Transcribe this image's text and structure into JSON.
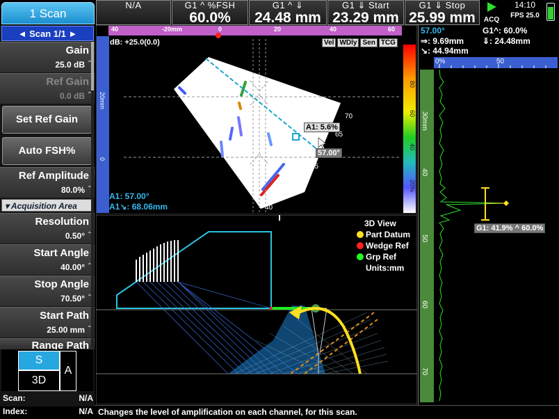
{
  "header": {
    "tab_label": "1 Scan",
    "readings": [
      {
        "label": "N/A",
        "value": ""
      },
      {
        "label": "G1 ^ %FSH",
        "value": "60.0%"
      },
      {
        "label": "G1 ^ ⇓",
        "value": "24.48 mm"
      },
      {
        "label": "G1 ⇓ Start",
        "value": "23.29 mm"
      },
      {
        "label": "G1 ⇓ Stop",
        "value": "25.99 mm"
      }
    ],
    "acq_label": "ACQ",
    "time": "14:10",
    "fps": "FPS 25.0"
  },
  "sidebar": {
    "scan_selector": "◄  Scan 1/1  ►",
    "params": [
      {
        "label": "Gain",
        "value": "25.0 dB",
        "disabled": false
      },
      {
        "label": "Ref Gain",
        "value": "0.0 dB",
        "disabled": true
      }
    ],
    "buttons": [
      "Set Ref Gain",
      "Auto FSH%"
    ],
    "params2": [
      {
        "label": "Ref Amplitude",
        "value": "80.0%"
      }
    ],
    "section": "▾ Acquisition Area",
    "params3": [
      {
        "label": "Resolution",
        "value": "0.50°"
      },
      {
        "label": "Start Angle",
        "value": "40.00°"
      },
      {
        "label": "Stop Angle",
        "value": "70.50°"
      },
      {
        "label": "Start Path",
        "value": "25.00 mm"
      },
      {
        "label": "Range Path",
        "value": ""
      }
    ],
    "view_s": "S",
    "view_a": "A",
    "view_3d": "3D",
    "scan_label": "Scan:",
    "scan_value": "N/A",
    "index_label": "Index:",
    "index_value": "N/A"
  },
  "sscan": {
    "db_label": "dB: +25.0(0.0)",
    "chips": [
      "Vel",
      "WDly",
      "Sen",
      "TCG"
    ],
    "top_ticks": [
      "40",
      "-20mm",
      "0",
      "20",
      "40",
      "60"
    ],
    "left_ticks": [
      "20mm",
      "0"
    ],
    "angles": [
      "70",
      "65",
      "55",
      "50",
      "45",
      "40"
    ],
    "cursor_tag": "A1: 5.6%",
    "angle_tag": "57.00°",
    "a1_angle": "A1: 57.00°",
    "a1_path": "A1↘: 68.06mm",
    "palette_ticks": [
      "80",
      "60",
      "40",
      "20%"
    ]
  },
  "view3d": {
    "title": "3D View",
    "legend": [
      {
        "label": "Part Datum",
        "color": "#ffe020"
      },
      {
        "label": "Wedge Ref",
        "color": "#ff2020"
      },
      {
        "label": "Grp Ref",
        "color": "#20ff20"
      }
    ],
    "units": "Units:mm"
  },
  "ascan": {
    "angle": "57.00°",
    "g1_fsh": "G1^: 60.0%",
    "r1": "⇒: 9.69mm",
    "r2": "⇓: 24.48mm",
    "r3": "↘: 44.94mm",
    "top_ticks": [
      "0%",
      "50"
    ],
    "left_ticks": [
      "30mm",
      "40",
      "50",
      "60",
      "70"
    ],
    "gate_tag": "G1: 41.9% ^ 60.0%"
  },
  "status_text": "Changes the level of amplification on each channel, for this scan."
}
